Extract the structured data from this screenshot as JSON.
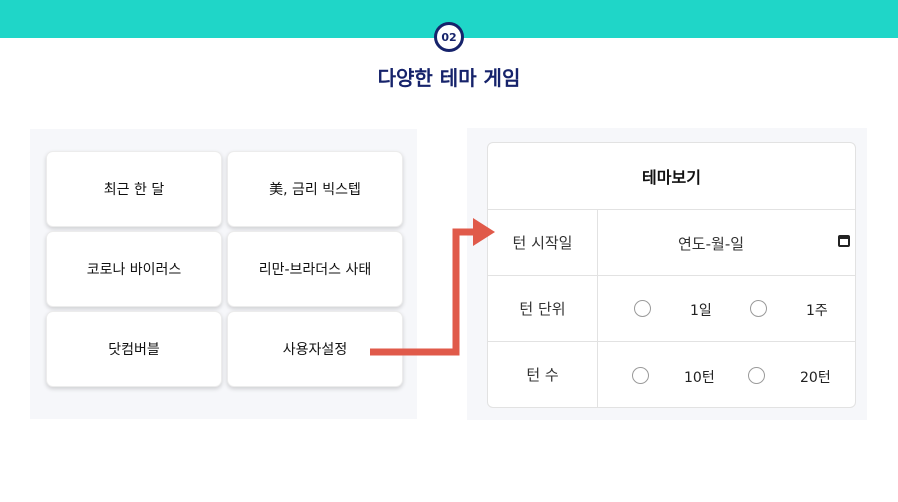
{
  "header": {
    "badge": "02",
    "title": "다양한 테마 게임"
  },
  "themes": [
    "최근 한 달",
    "美, 금리 빅스텝",
    "코로나 바이러스",
    "리만-브라더스 사태",
    "닷컴버블",
    "사용자설정"
  ],
  "form": {
    "title": "테마보기",
    "start_label": "턴 시작일",
    "date_placeholder": "연도-월-일",
    "unit_label": "턴 단위",
    "unit_options": [
      "1일",
      "1주"
    ],
    "count_label": "턴 수",
    "count_options": [
      "10턴",
      "20턴"
    ]
  },
  "colors": {
    "top_bar": "#1fd6c8",
    "heading": "#16236b",
    "arrow": "#e05a4a"
  },
  "icons": [
    "calendar-icon",
    "arrow-icon"
  ]
}
